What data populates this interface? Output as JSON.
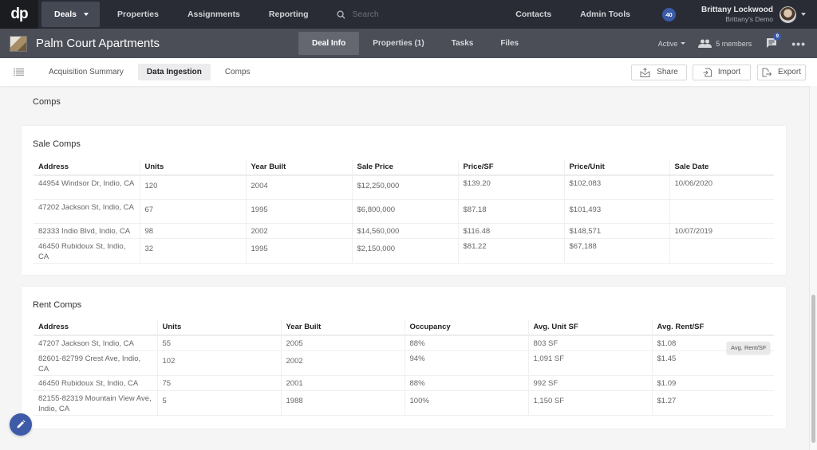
{
  "topnav": {
    "logo": "dp",
    "items": [
      {
        "label": "Deals",
        "active": true,
        "has_caret": true
      },
      {
        "label": "Properties"
      },
      {
        "label": "Assignments"
      },
      {
        "label": "Reporting"
      }
    ],
    "search_placeholder": "Search",
    "right_items": [
      {
        "label": "Contacts"
      },
      {
        "label": "Admin Tools"
      }
    ],
    "notification_count": "40",
    "user": {
      "name": "Brittany Lockwood",
      "org": "Brittany's Demo"
    }
  },
  "deal": {
    "title": "Palm Court Apartments",
    "tabs": [
      {
        "label": "Deal Info",
        "active": true
      },
      {
        "label": "Properties (1)"
      },
      {
        "label": "Tasks"
      },
      {
        "label": "Files"
      }
    ],
    "status": "Active",
    "members": "5 members",
    "chat_badge": "9",
    "more": "•••"
  },
  "subnav": {
    "tabs": [
      {
        "label": "Acquisition Summary"
      },
      {
        "label": "Data Ingestion",
        "active": true
      },
      {
        "label": "Comps"
      }
    ],
    "buttons": {
      "share": "Share",
      "import": "Import",
      "export": "Export"
    }
  },
  "main": {
    "section_title": "Comps",
    "sale_comps": {
      "title": "Sale Comps",
      "headers": [
        "Address",
        "Units",
        "Year Built",
        "Sale Price",
        "Price/SF",
        "Price/Unit",
        "Sale Date"
      ],
      "rows": [
        [
          "44954 Windsor Dr, Indio, CA",
          "120",
          "2004",
          "$12,250,000",
          "$139.20",
          "$102,083",
          "10/06/2020"
        ],
        [
          "47202 Jackson St, Indio, CA",
          "67",
          "1995",
          "$6,800,000",
          "$87.18",
          "$101,493",
          ""
        ],
        [
          "82333 Indio Blvd, Indio, CA",
          "98",
          "2002",
          "$14,560,000",
          "$116.48",
          "$148,571",
          "10/07/2019"
        ],
        [
          "46450 Rubidoux St, Indio, CA",
          "32",
          "1995",
          "$2,150,000",
          "$81.22",
          "$67,188",
          ""
        ]
      ]
    },
    "rent_comps": {
      "title": "Rent Comps",
      "headers": [
        "Address",
        "Units",
        "Year Built",
        "Occupancy",
        "Avg. Unit SF",
        "Avg. Rent/SF"
      ],
      "rows": [
        [
          "47207 Jackson St, Indio, CA",
          "55",
          "2005",
          "88%",
          "803 SF",
          "$1.08"
        ],
        [
          "82601-82799 Crest Ave, Indio, CA",
          "102",
          "2002",
          "94%",
          "1,091 SF",
          "$1.45"
        ],
        [
          "46450 Rubidoux St, Indio, CA",
          "75",
          "2001",
          "88%",
          "992 SF",
          "$1.09"
        ],
        [
          "82155-82319 Mountain View Ave, Indio, CA",
          "5",
          "1988",
          "100%",
          "1,150 SF",
          "$1.27"
        ]
      ]
    },
    "tooltip": "Avg. Rent/SF"
  },
  "colors": {
    "topnav_bg": "#292c35",
    "dealbar_bg": "#4b4e57",
    "accent": "#3e5ba8"
  }
}
